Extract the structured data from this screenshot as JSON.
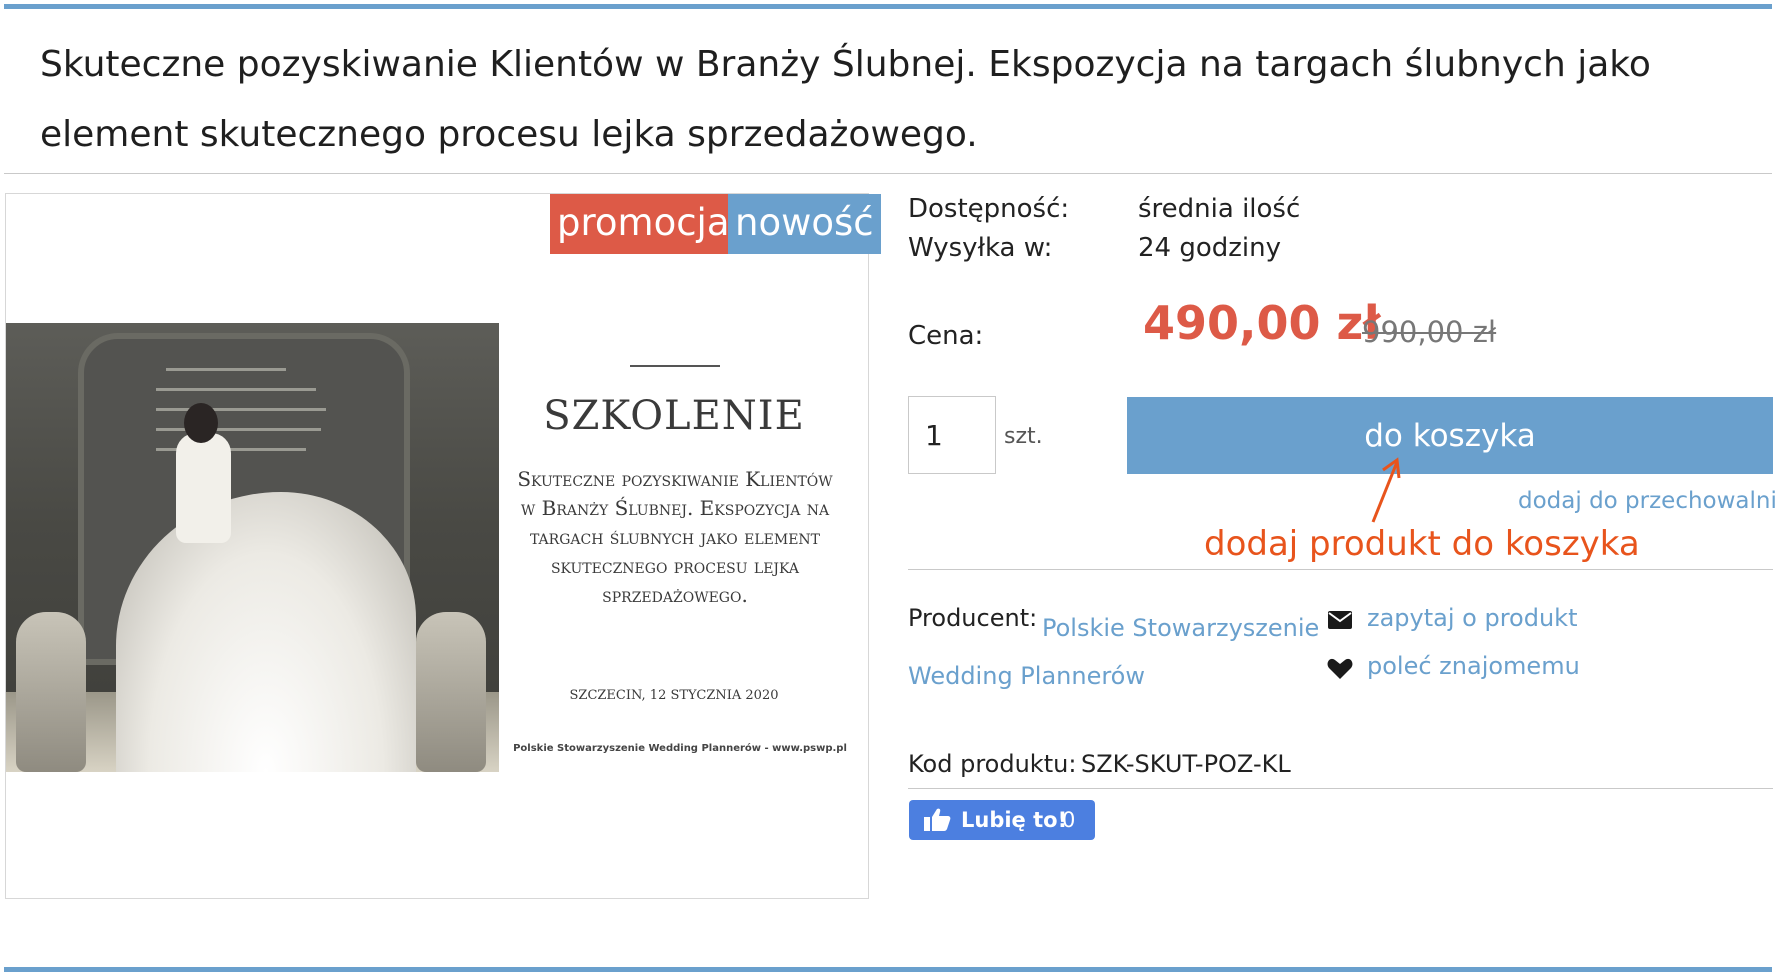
{
  "product": {
    "title": "Skuteczne pozyskiwanie Klientów w Branży Ślubnej. Ekspozycja na targach ślubnych jako element skutecznego procesu lejka sprzedażowego.",
    "badges": {
      "promo": "promocja",
      "new": "nowość"
    },
    "colors": {
      "accent": "#6aa0cd",
      "promo": "#dd5a47",
      "annotation": "#e8541c"
    }
  },
  "flyer": {
    "heading": "SZKOLENIE",
    "body": "Skuteczne pozyskiwanie Klientów w Branży Ślubnej. Ekspozycja na targach ślubnych jako element skutecznego procesu lejka sprzedażowego.",
    "place_date": "SZCZECIN, 12 STYCZNIA 2020",
    "footer": "Polskie Stowarzyszenie Wedding Plannerów - www.pswp.pl"
  },
  "availability": {
    "label": "Dostępność:",
    "value": "średnia ilość"
  },
  "shipping": {
    "label": "Wysyłka w:",
    "value": "24 godziny"
  },
  "price": {
    "label": "Cena:",
    "current": "490,00 zł",
    "old": "990,00 zł"
  },
  "cart": {
    "quantity": "1",
    "unit": "szt.",
    "button_label": "do koszyka",
    "wishlist_label": "dodaj do przechowalni",
    "annotation": "dodaj produkt do koszyka"
  },
  "details": {
    "producer_label": "Producent:",
    "producer_name": "Polskie Stowarzyszenie Wedding Plannerów",
    "ask_label": "zapytaj o produkt",
    "recommend_label": "poleć znajomemu",
    "code_label": "Kod produktu:",
    "code_value": "SZK-SKUT-POZ-KL"
  },
  "like": {
    "label": "Lubię to!",
    "count": "0",
    "icon": "thumbs-up-icon"
  }
}
